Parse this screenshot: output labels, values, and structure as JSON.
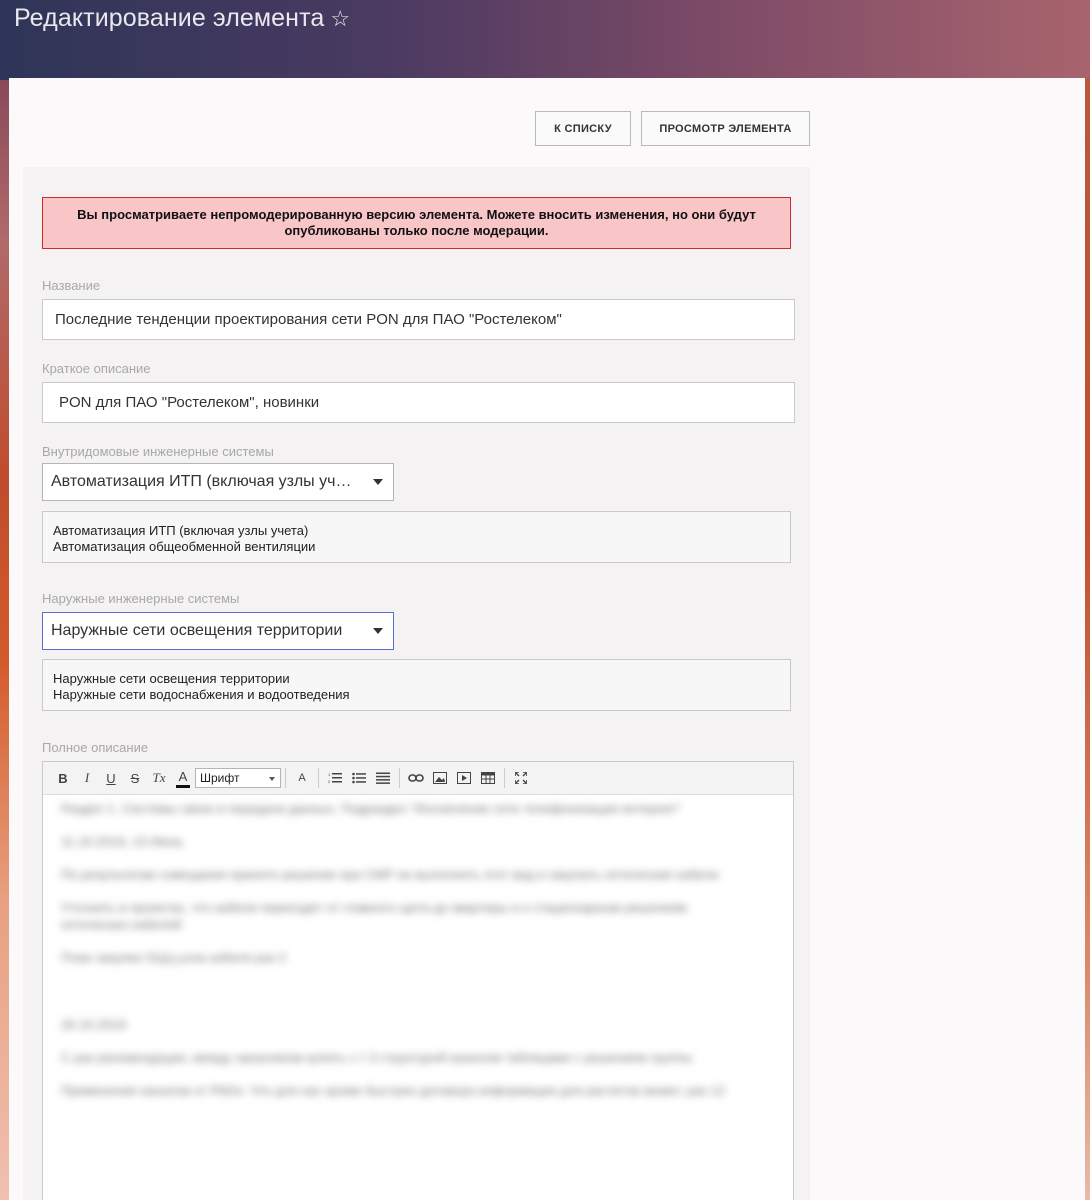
{
  "header": {
    "title": "Редактирование элемента",
    "star": "☆"
  },
  "actions": {
    "list_label": "К списку",
    "view_label": "Просмотр элемента"
  },
  "alert": {
    "text": "Вы просматриваете непромодерированную версию элемента. Можете вносить изменения, но они будут опубликованы только после модерации."
  },
  "fields": {
    "name": {
      "label": "Название",
      "value": "Последние тенденции проектирования сети PON для ПАО \"Ростелеком\""
    },
    "short": {
      "label": "Краткое описание",
      "value": "PON для ПАО \"Ростелеком\", новинки"
    },
    "internal": {
      "label": "Внутридомовые инженерные системы",
      "selected": "Автоматизация ИТП (включая узлы учета)",
      "chosen": [
        "Автоматизация ИТП (включая узлы учета)",
        "Автоматизация общеобменной вентиляции"
      ]
    },
    "external": {
      "label": "Наружные инженерные системы",
      "selected": "Наружные сети освещения территории",
      "chosen": [
        "Наружные сети освещения территории",
        "Наружные сети водоснабжения и водоотведения"
      ]
    },
    "full": {
      "label": "Полное описание"
    }
  },
  "editor": {
    "toolbar": {
      "bold": "B",
      "italic": "I",
      "underline": "U",
      "strike": "S",
      "clear": "Tx",
      "color": "A",
      "font": "Шрифт",
      "size": "A"
    },
    "icons": [
      "bold-icon",
      "italic-icon",
      "underline-icon",
      "strike-icon",
      "clear-format-icon",
      "text-color-icon",
      "font-size-icon",
      "numbered-list-icon",
      "bullet-list-icon",
      "align-justify-icon",
      "link-icon",
      "image-icon",
      "video-icon",
      "table-icon",
      "fullscreen-icon"
    ],
    "content": [
      "Раздел 1. Системы связи и передачи данных. Подраздел \"Исключение сети теле­фонизации интернет\"",
      "11.10.2019, 13 Июнь",
      "По результатам совещания принято решение при СМР не выполнять этот вид и закупать оптические кабели",
      "Уточнить в проектах, что кабели переходят от главного щита до квартиры и к стационарным решениям оптических кабелей",
      "План закупки ОЦЦ-узла кабеля раз 2",
      "26.10.2019",
      "С раз рекомендации, между заказчиком купить с т 3 структурой каналом таблицами с решением группы",
      "Применение каналов от PADs: Что для нас кроме быстрее договора информации для расчетов может, раз 12"
    ]
  }
}
